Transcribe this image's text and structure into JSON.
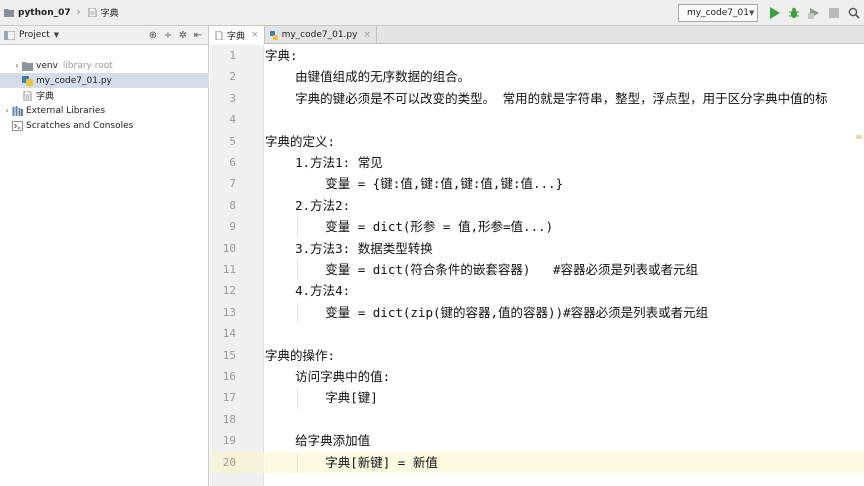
{
  "navbar": {
    "breadcrumbs": [
      "python_07",
      "字典"
    ],
    "run_config": "my_code7_01",
    "buttons": [
      "run-icon",
      "debug-icon",
      "coverage-icon",
      "stop-icon",
      "search-everywhere-icon"
    ]
  },
  "project": {
    "header_label": "Project",
    "tree": [
      {
        "label": "venv",
        "hint": "library root",
        "icon": "folder-icon",
        "level": 1,
        "expandable": true
      },
      {
        "label": "my_code7_01.py",
        "hint": "",
        "icon": "python-file-icon",
        "level": 1,
        "expandable": false,
        "selected": true
      },
      {
        "label": "字典",
        "hint": "",
        "icon": "text-file-icon",
        "level": 1,
        "expandable": false
      },
      {
        "label": "External Libraries",
        "hint": "",
        "icon": "library-icon",
        "level": 0,
        "expandable": true
      },
      {
        "label": "Scratches and Consoles",
        "hint": "",
        "icon": "scratches-icon",
        "level": 0,
        "expandable": false
      }
    ]
  },
  "tabs": [
    {
      "label": "字典",
      "active": true
    },
    {
      "label": "my_code7_01.py",
      "active": false
    }
  ],
  "editor": {
    "caret_line": 20,
    "lines": [
      {
        "num": "1",
        "text": "字典:"
      },
      {
        "num": "2",
        "text": "    由键值组成的无序数据的组合。"
      },
      {
        "num": "3",
        "text": "    字典的键必须是不可以改变的类型。 常用的就是字符串，整型，浮点型，用于区分字典中值的标"
      },
      {
        "num": "4",
        "text": ""
      },
      {
        "num": "5",
        "text": "字典的定义:"
      },
      {
        "num": "6",
        "text": "    1.方法1: 常见"
      },
      {
        "num": "7",
        "text": "        变量 = {键:值,键:值,键:值,键:值...}"
      },
      {
        "num": "8",
        "text": "    2.方法2:"
      },
      {
        "num": "9",
        "text": "        变量 = dict(形参 = 值,形参=值...)"
      },
      {
        "num": "10",
        "text": "    3.方法3: 数据类型转换"
      },
      {
        "num": "11",
        "text": "        变量 = dict(符合条件的嵌套容器)   #容器必须是列表或者元组"
      },
      {
        "num": "12",
        "text": "    4.方法4:"
      },
      {
        "num": "13",
        "text": "        变量 = dict(zip(键的容器,值的容器))#容器必须是列表或者元组"
      },
      {
        "num": "14",
        "text": ""
      },
      {
        "num": "15",
        "text": "字典的操作:"
      },
      {
        "num": "16",
        "text": "    访问字典中的值:"
      },
      {
        "num": "17",
        "text": "        字典[键]"
      },
      {
        "num": "18",
        "text": ""
      },
      {
        "num": "19",
        "text": "    给字典添加值"
      },
      {
        "num": "20",
        "text": "        字典[新键] = 新值"
      }
    ]
  }
}
